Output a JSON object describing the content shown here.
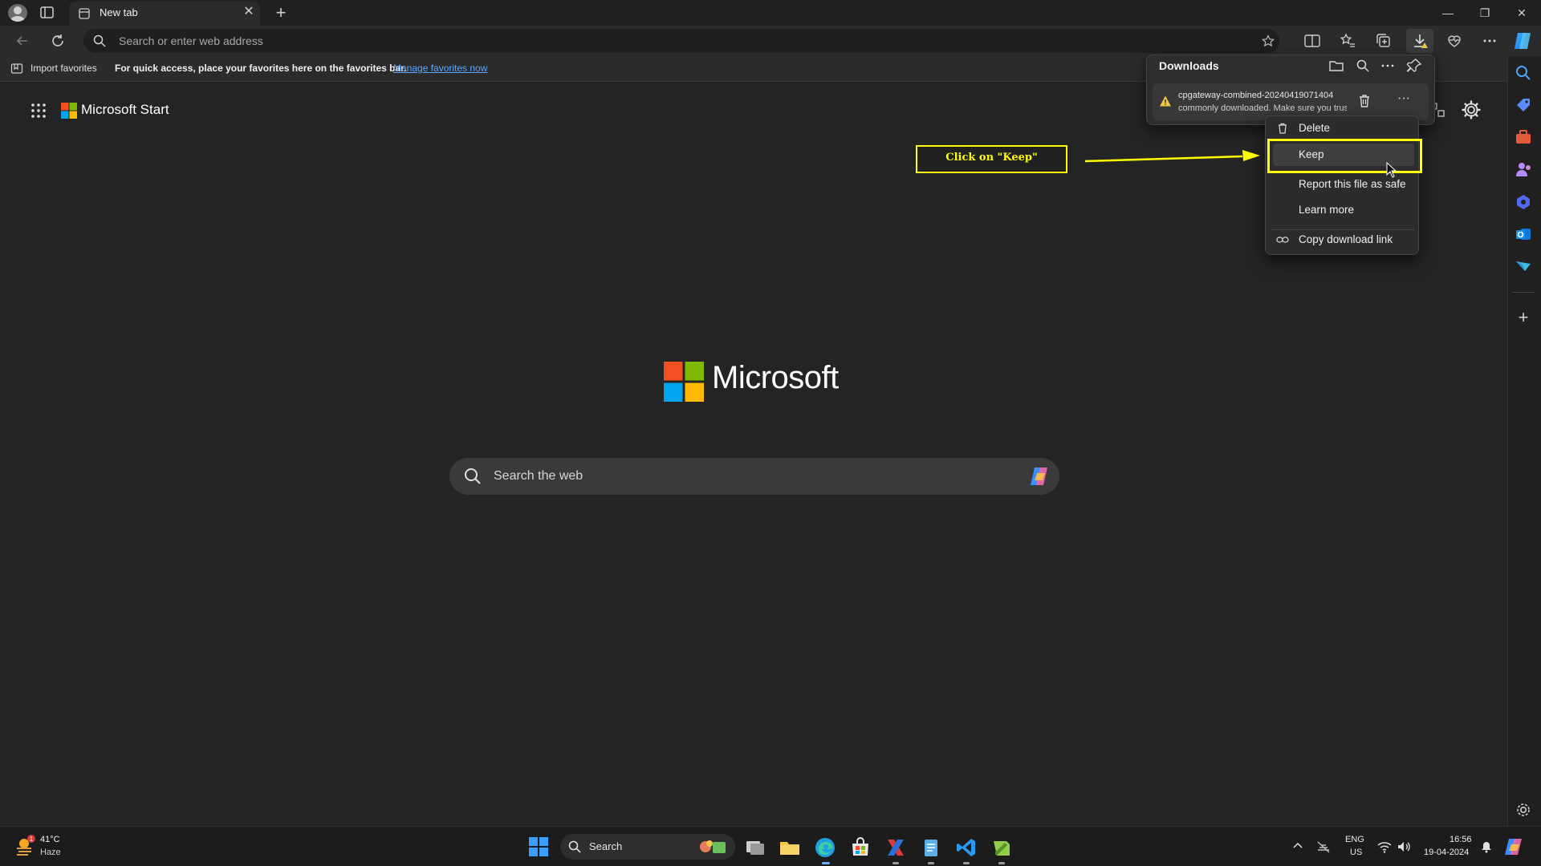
{
  "browser": {
    "tab_title": "New tab",
    "new_tab_symbol": "+",
    "close_symbol": "✕",
    "address_placeholder": "Search or enter web address",
    "window_controls": [
      "—",
      "❐",
      "✕"
    ]
  },
  "favorites_bar": {
    "import_label": "Import favorites",
    "message": "For quick access, place your favorites here on the favorites bar.",
    "manage_link": "Manage favorites now"
  },
  "new_tab_page": {
    "brand_label": "Microsoft Start",
    "logo_wordmark": "Microsoft",
    "search_placeholder": "Search the web"
  },
  "downloads": {
    "title": "Downloads",
    "item": {
      "filename": "cpgateway-combined-20240419071404",
      "description": "commonly downloaded. Make sure you trust",
      "more_symbol": "···"
    },
    "menu": {
      "delete": "Delete",
      "keep": "Keep",
      "report": "Report this file as safe",
      "learn_more": "Learn more",
      "copy_link": "Copy download link"
    }
  },
  "annotation": {
    "text": "Click on \"Keep\"",
    "color": "#ffff00"
  },
  "taskbar": {
    "weather_badge": "1",
    "weather_temp": "41°C",
    "weather_condition": "Haze",
    "search_label": "Search",
    "tray_lang_top": "ENG",
    "tray_lang_bottom": "US",
    "clock_time": "16:56",
    "clock_date": "19-04-2024"
  },
  "colors": {
    "accent_blue": "#5ea8ff",
    "ms_red": "#f25022",
    "ms_green": "#7fba00",
    "ms_blue": "#00a4ef",
    "ms_yellow": "#ffb900"
  }
}
